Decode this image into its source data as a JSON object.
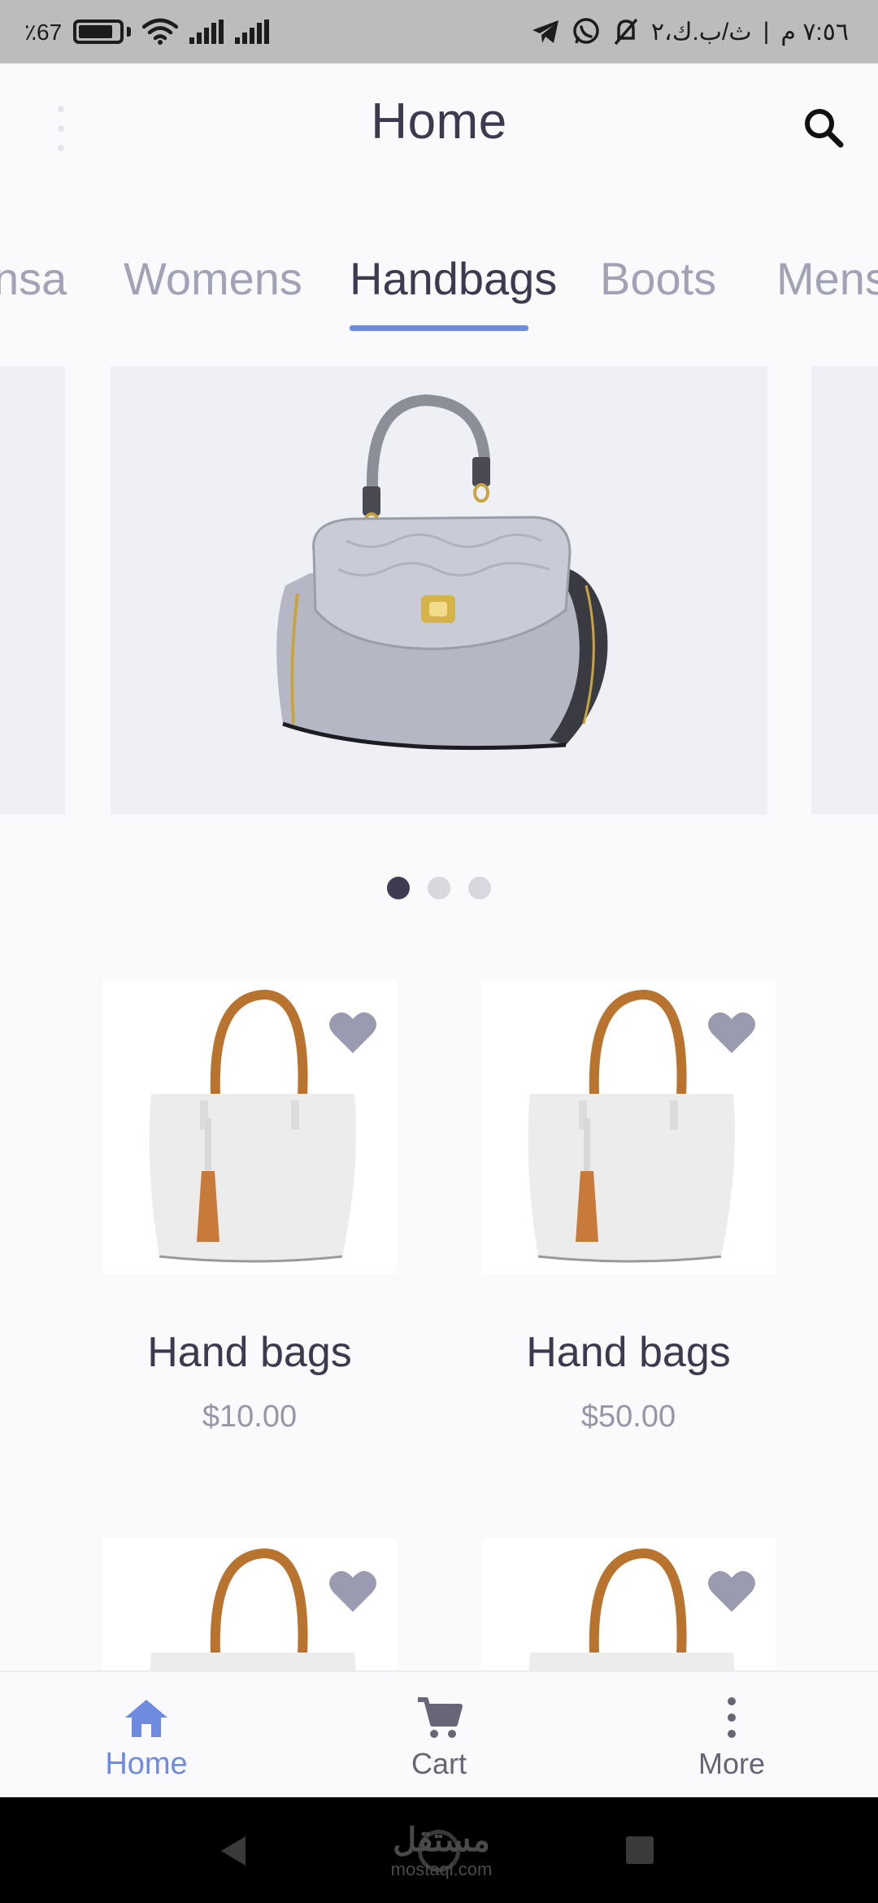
{
  "status_bar": {
    "time": "٧:٥٦ م",
    "date": "ث/ب.ك،٢",
    "battery_level": "67",
    "battery_fraction": 0.85
  },
  "app_bar": {
    "title": "Home",
    "menu_icon": "vertical-dots-icon",
    "search_icon": "search-icon"
  },
  "tabs": [
    {
      "label": "nsa"
    },
    {
      "label": "Womens"
    },
    {
      "label": "Handbags",
      "active": true
    },
    {
      "label": "Boots"
    },
    {
      "label": "Mens"
    }
  ],
  "carousel": {
    "pages": 3,
    "active_page": 1
  },
  "products": [
    {
      "name": "Hand bags",
      "price": "$10.00"
    },
    {
      "name": "Hand bags",
      "price": "$50.00"
    },
    {
      "name": "",
      "price": ""
    },
    {
      "name": "",
      "price": ""
    }
  ],
  "bottom_nav": {
    "items": [
      {
        "label": "Home",
        "icon": "home-icon",
        "active": true
      },
      {
        "label": "Cart",
        "icon": "cart-icon"
      },
      {
        "label": "More",
        "icon": "more-vertical-icon"
      }
    ]
  },
  "watermark": {
    "text": "مستقل",
    "sub": "mostaql.com"
  },
  "colors": {
    "accent": "#6f8be0",
    "title": "#3b3a4e",
    "muted": "#a2a2b6",
    "heart": "#9a9ab0"
  }
}
